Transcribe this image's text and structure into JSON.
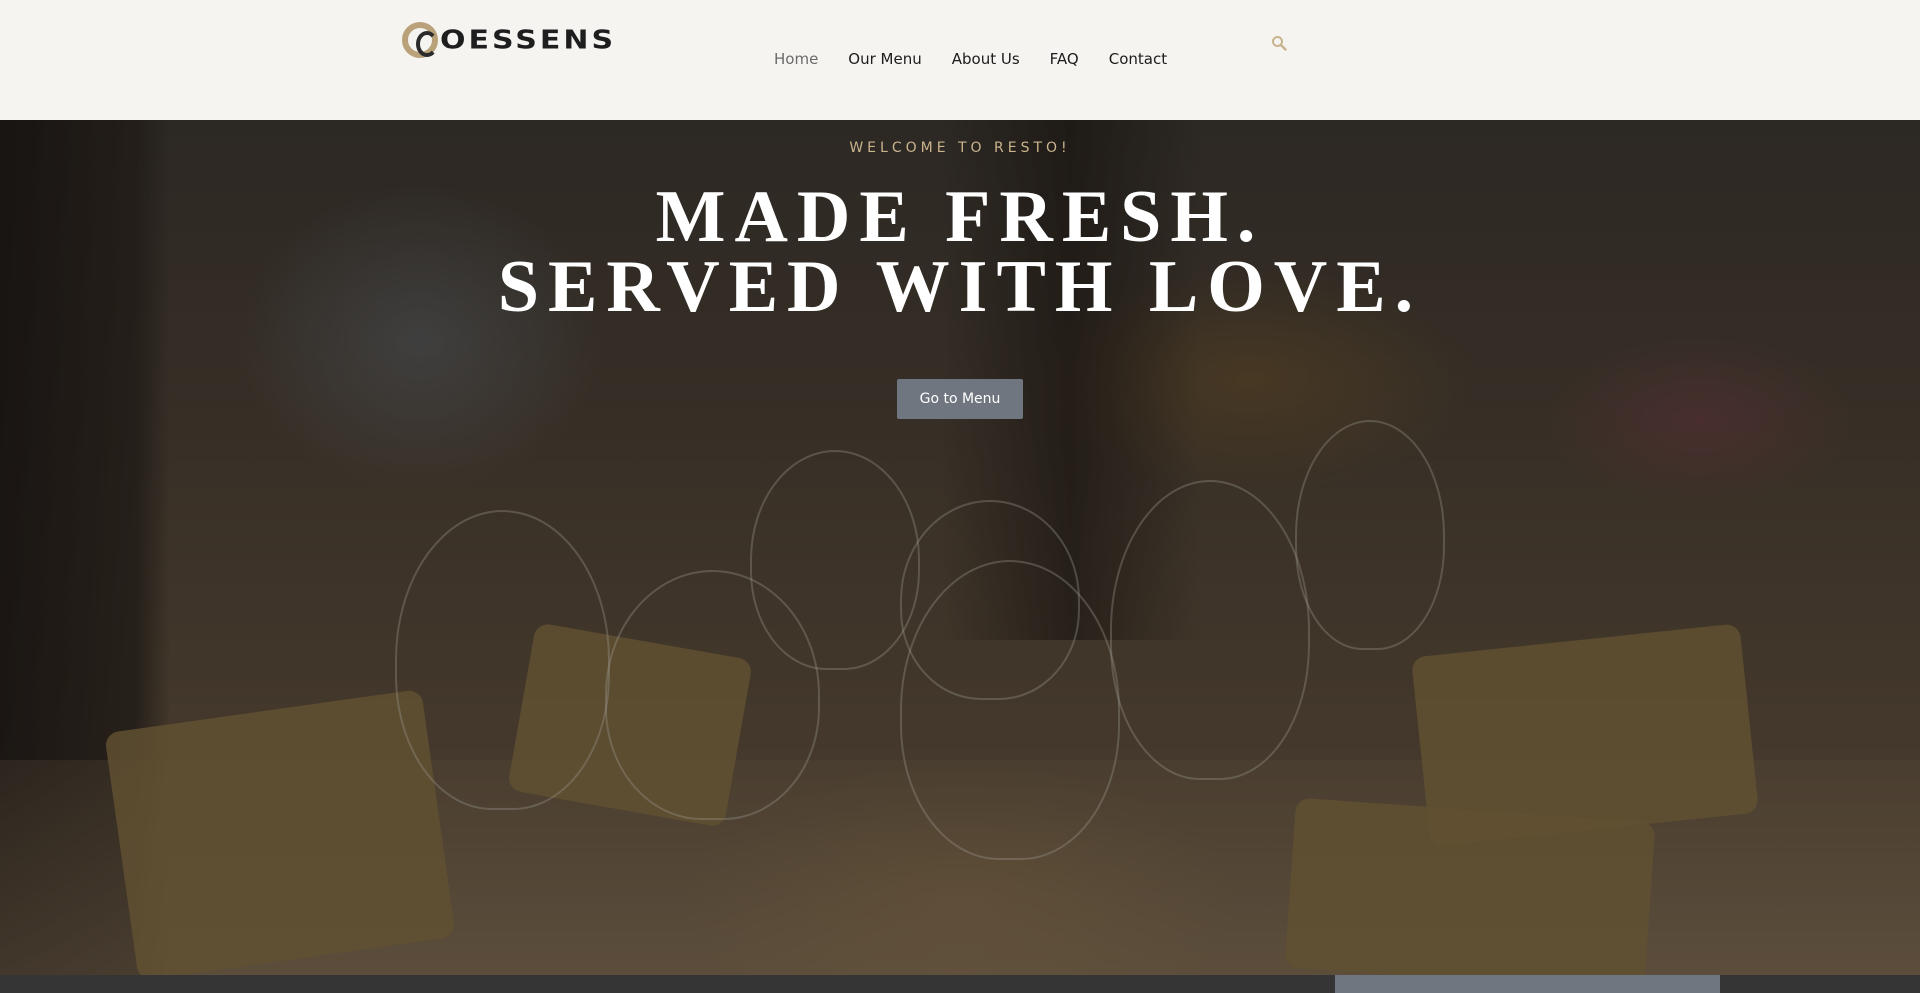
{
  "brand": {
    "name": "OESSENS",
    "logo_letter": "C"
  },
  "nav": {
    "items": [
      {
        "label": "Home",
        "active": true
      },
      {
        "label": "Our Menu",
        "active": false
      },
      {
        "label": "About Us",
        "active": false
      },
      {
        "label": "FAQ",
        "active": false
      },
      {
        "label": "Contact",
        "active": false
      }
    ]
  },
  "search": {
    "icon": "search-icon"
  },
  "hero": {
    "eyebrow": "WELCOME TO RESTO!",
    "headline_line1": "MADE FRESH.",
    "headline_line2": "SERVED WITH LOVE.",
    "cta_label": "Go to Menu"
  },
  "colors": {
    "accent_gold": "#b9a27a",
    "eyebrow": "#c9b48e",
    "button": "#6f767f",
    "header_bg": "#f6f4f1"
  }
}
